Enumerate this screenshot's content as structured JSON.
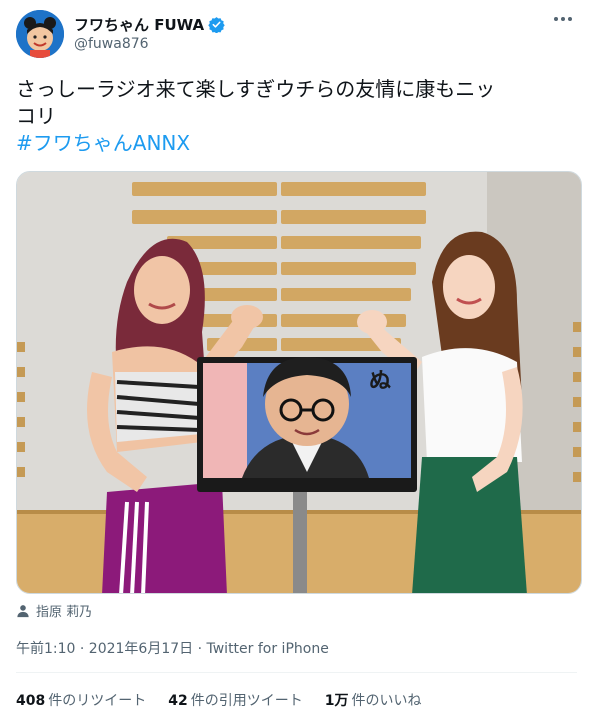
{
  "author": {
    "display_name": "フワちゃん FUWA",
    "handle": "@fuwa876",
    "avatar_icon": "avatar-icon",
    "verified_icon": "verified-badge-icon",
    "verified_color": "#1d9bf0"
  },
  "more_icon": "more-options-icon",
  "tweet": {
    "text_line1": "さっしーラジオ来て楽しすぎウチらの友情に康もニッ",
    "text_line2": "コリ",
    "hashtag": "#フワちゃんANNX"
  },
  "photo": {
    "monitor_text": "ぬ"
  },
  "tagged_user": "指原 莉乃",
  "timestamp": "午前1:10 · 2021年6月17日 · Twitter for iPhone",
  "stats": {
    "retweets_count": "408",
    "retweets_label": "件のリツイート",
    "quotes_count": "42",
    "quotes_label": "件の引用ツイート",
    "likes_count": "1万",
    "likes_label": "件のいいね"
  },
  "colors": {
    "hashtag": "#1d9bf0",
    "secondary_text": "#536471",
    "divider": "#eff3f4"
  }
}
